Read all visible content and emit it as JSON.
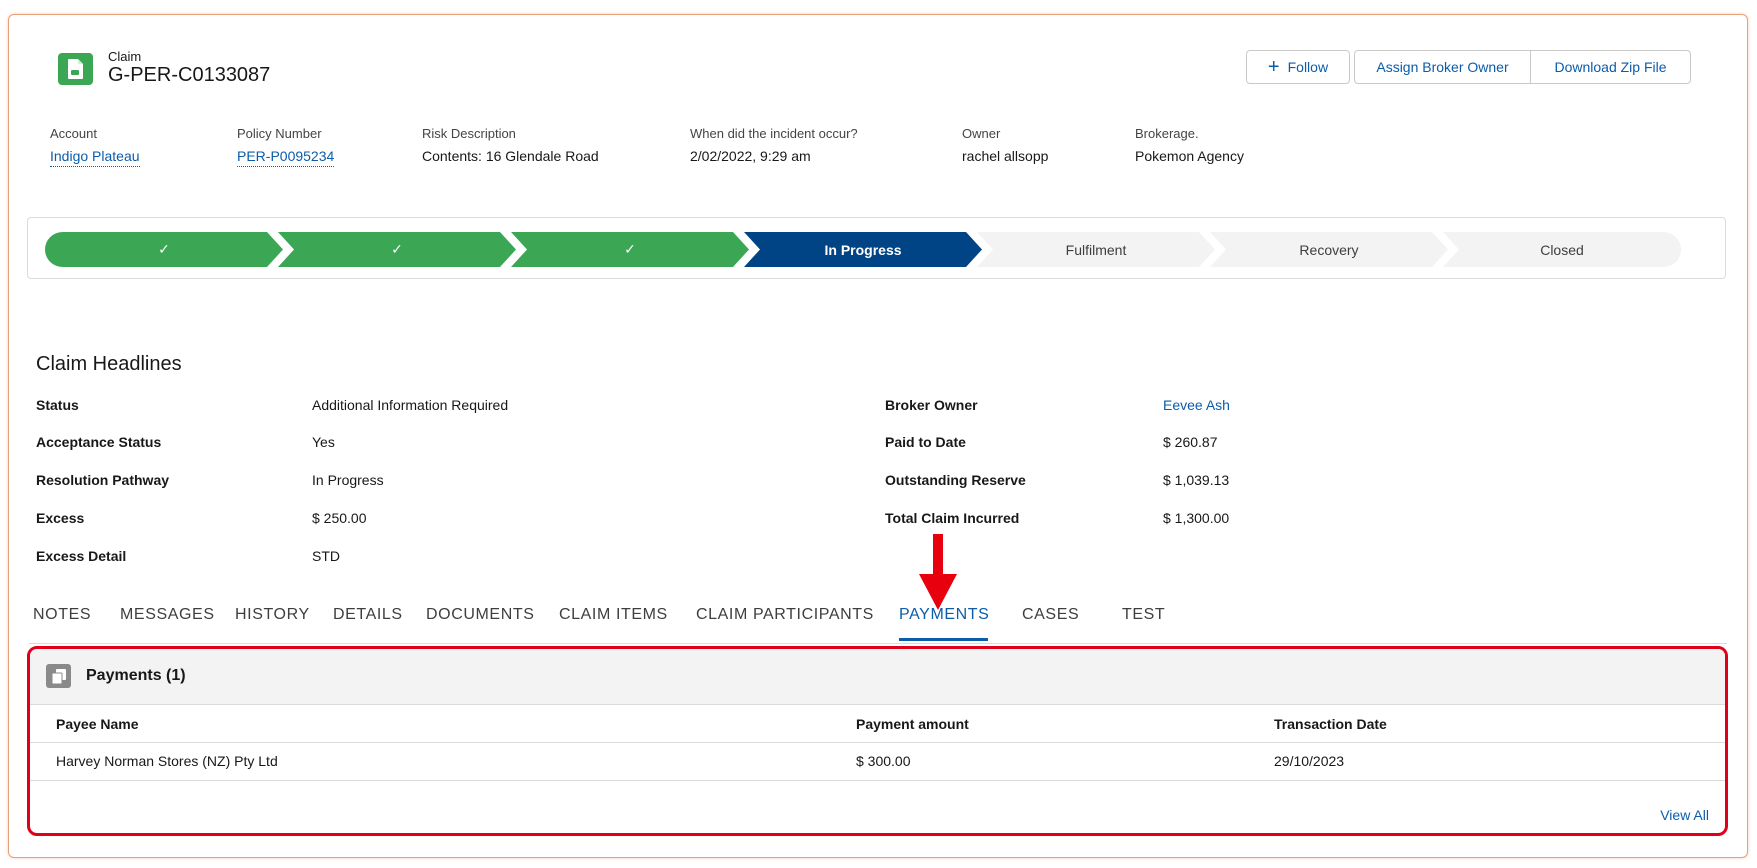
{
  "header": {
    "record_type": "Claim",
    "record_name": "G-PER-C0133087",
    "icon": "claim-record-icon",
    "buttons": {
      "follow": "Follow",
      "assign": "Assign Broker Owner",
      "download": "Download Zip File"
    },
    "fields": [
      {
        "label": "Account",
        "value": "Indigo Plateau"
      },
      {
        "label": "Policy Number",
        "value": "PER-P0095234"
      },
      {
        "label": "Risk Description",
        "value": "Contents: 16 Glendale Road"
      },
      {
        "label": "When did the incident occur?",
        "value": "2/02/2022, 9:29 am"
      },
      {
        "label": "Owner",
        "value": "rachel allsopp"
      },
      {
        "label": "Brokerage.",
        "value": "Pokemon Agency"
      }
    ]
  },
  "path": {
    "completed_mark": "✓",
    "stages": [
      "In Progress",
      "Fulfilment",
      "Recovery",
      "Closed"
    ]
  },
  "headlines": {
    "title": "Claim Headlines",
    "left": [
      {
        "label": "Status",
        "value": "Additional Information Required"
      },
      {
        "label": "Acceptance Status",
        "value": "Yes"
      },
      {
        "label": "Resolution Pathway",
        "value": "In Progress"
      },
      {
        "label": "Excess",
        "value": "$ 250.00"
      },
      {
        "label": "Excess Detail",
        "value": "STD"
      }
    ],
    "right": [
      {
        "label": "Broker Owner",
        "value": "Eevee Ash"
      },
      {
        "label": "Paid to Date",
        "value": "$ 260.87"
      },
      {
        "label": "Outstanding Reserve",
        "value": "$ 1,039.13"
      },
      {
        "label": "Total Claim Incurred",
        "value": "$ 1,300.00"
      }
    ]
  },
  "tabs": [
    "NOTES",
    "MESSAGES",
    "HISTORY",
    "DETAILS",
    "DOCUMENTS",
    "CLAIM ITEMS",
    "CLAIM PARTICIPANTS",
    "PAYMENTS",
    "CASES",
    "TEST"
  ],
  "active_tab": "PAYMENTS",
  "payments": {
    "title": "Payments (1)",
    "columns": [
      "Payee Name",
      "Payment amount",
      "Transaction Date"
    ],
    "rows": [
      [
        "Harvey Norman Stores (NZ) Pty Ltd",
        "$ 300.00",
        "29/10/2023"
      ]
    ],
    "view_all": "View All"
  },
  "colors": {
    "brand_blue": "#0b5cab",
    "path_complete": "#3ba755",
    "path_current": "#014486",
    "highlight_red": "#e0001a"
  }
}
